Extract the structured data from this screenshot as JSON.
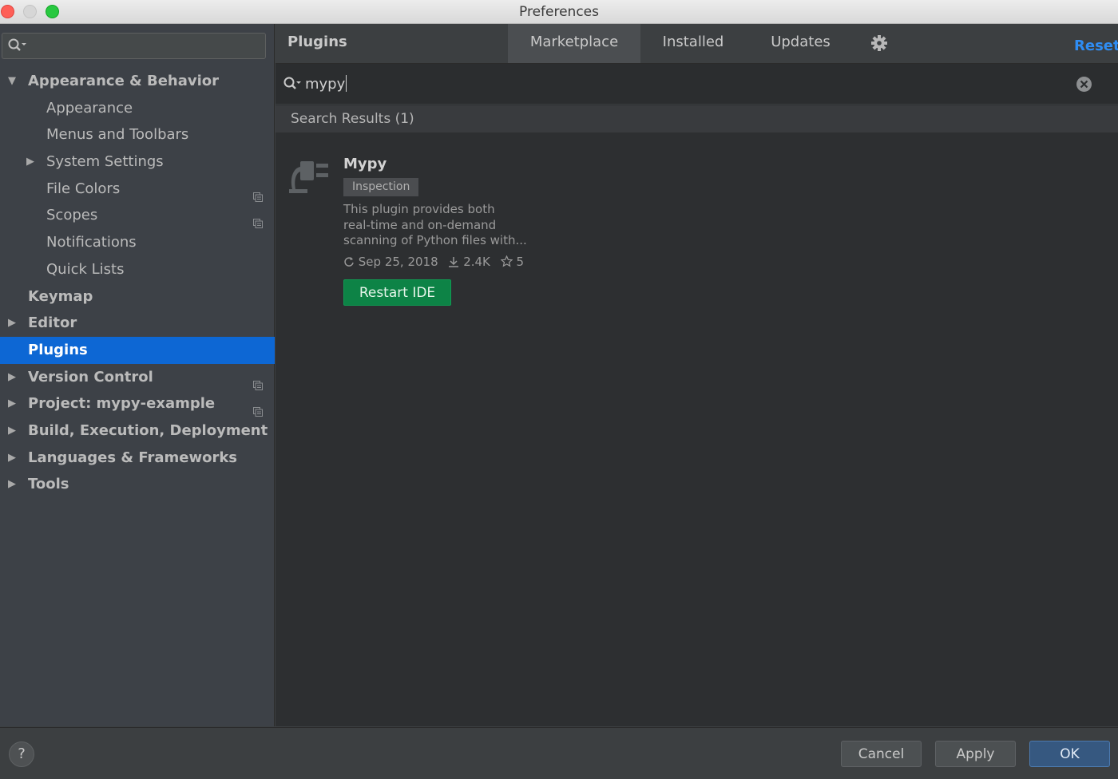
{
  "window": {
    "title": "Preferences"
  },
  "sidebar": {
    "search_value": "",
    "items": [
      {
        "label": "Appearance & Behavior",
        "bold": true,
        "arrow": "down",
        "indent": 0,
        "selected": false,
        "project": false
      },
      {
        "label": "Appearance",
        "bold": false,
        "arrow": "",
        "indent": 1,
        "selected": false,
        "project": false
      },
      {
        "label": "Menus and Toolbars",
        "bold": false,
        "arrow": "",
        "indent": 1,
        "selected": false,
        "project": false
      },
      {
        "label": "System Settings",
        "bold": false,
        "arrow": "right",
        "indent": 1,
        "selected": false,
        "project": false
      },
      {
        "label": "File Colors",
        "bold": false,
        "arrow": "",
        "indent": 1,
        "selected": false,
        "project": true
      },
      {
        "label": "Scopes",
        "bold": false,
        "arrow": "",
        "indent": 1,
        "selected": false,
        "project": true
      },
      {
        "label": "Notifications",
        "bold": false,
        "arrow": "",
        "indent": 1,
        "selected": false,
        "project": false
      },
      {
        "label": "Quick Lists",
        "bold": false,
        "arrow": "",
        "indent": 1,
        "selected": false,
        "project": false
      },
      {
        "label": "Keymap",
        "bold": true,
        "arrow": "",
        "indent": 0,
        "selected": false,
        "project": false
      },
      {
        "label": "Editor",
        "bold": true,
        "arrow": "right",
        "indent": 0,
        "selected": false,
        "project": false
      },
      {
        "label": "Plugins",
        "bold": true,
        "arrow": "",
        "indent": 0,
        "selected": true,
        "project": false
      },
      {
        "label": "Version Control",
        "bold": true,
        "arrow": "right",
        "indent": 0,
        "selected": false,
        "project": true
      },
      {
        "label": "Project: mypy-example",
        "bold": true,
        "arrow": "right",
        "indent": 0,
        "selected": false,
        "project": true
      },
      {
        "label": "Build, Execution, Deployment",
        "bold": true,
        "arrow": "right",
        "indent": 0,
        "selected": false,
        "project": false
      },
      {
        "label": "Languages & Frameworks",
        "bold": true,
        "arrow": "right",
        "indent": 0,
        "selected": false,
        "project": false
      },
      {
        "label": "Tools",
        "bold": true,
        "arrow": "right",
        "indent": 0,
        "selected": false,
        "project": false
      }
    ]
  },
  "plugins": {
    "title": "Plugins",
    "tabs": [
      "Marketplace",
      "Installed",
      "Updates"
    ],
    "active_tab": "Marketplace",
    "reset_label": "Reset",
    "search_query": "mypy",
    "results_header": "Search Results (1)",
    "result": {
      "name": "Mypy",
      "tag": "Inspection",
      "description": [
        "This plugin provides both",
        "real-time and on-demand",
        "scanning of Python files with..."
      ],
      "date": "Sep 25, 2018",
      "downloads": "2.4K",
      "rating": "5",
      "action_label": "Restart IDE"
    }
  },
  "footer": {
    "help_label": "?",
    "cancel_label": "Cancel",
    "apply_label": "Apply",
    "ok_label": "OK"
  },
  "colors": {
    "selection": "#0d67d4",
    "accent_link": "#2f8df4",
    "install_green": "#0d8346",
    "ok_blue": "#365880"
  },
  "icons": {
    "search": "search-icon",
    "gear": "gear-icon",
    "clear": "clear-icon",
    "plugin": "plugin-plug-icon",
    "refresh": "refresh-icon",
    "download": "download-icon",
    "star": "star-icon",
    "project_scope": "project-scope-icon"
  }
}
